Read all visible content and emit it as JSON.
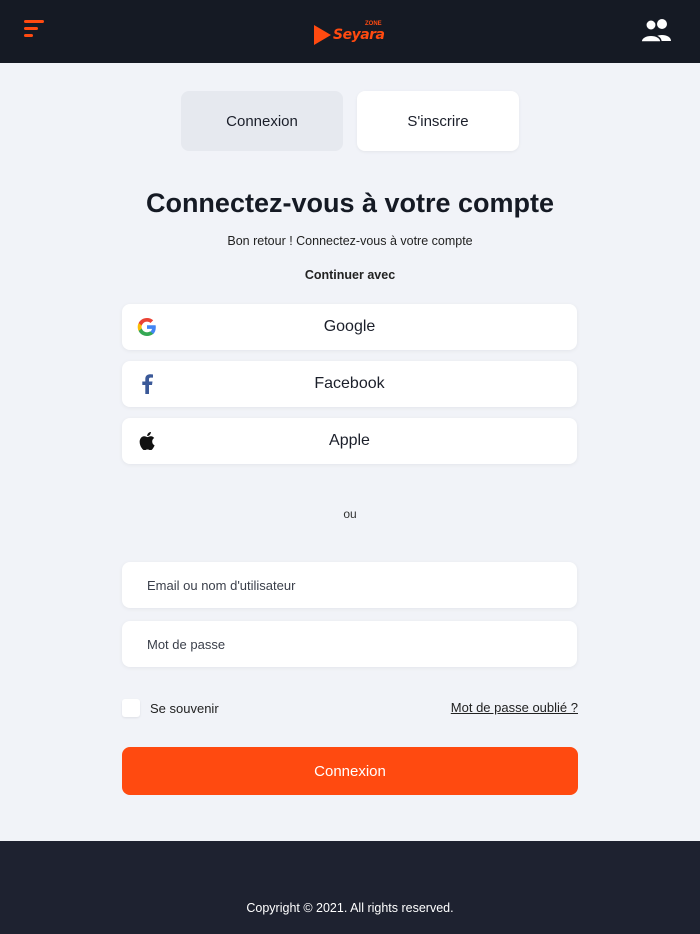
{
  "header": {
    "menu_icon": "hamburger-menu-icon",
    "logo_text": "Seyara",
    "logo_badge": "ZONE",
    "users_icon": "users-icon"
  },
  "tabs": [
    {
      "label": "Connexion",
      "active": true
    },
    {
      "label": "S'inscrire",
      "active": false
    }
  ],
  "heading": {
    "title": "Connectez-vous à votre compte",
    "subtitle": "Bon retour ! Connectez-vous à votre compte",
    "continue_with": "Continuer avec"
  },
  "social": {
    "google": {
      "label": "Google",
      "icon": "google-icon"
    },
    "facebook": {
      "label": "Facebook",
      "icon": "facebook-icon"
    },
    "apple": {
      "label": "Apple",
      "icon": "apple-icon"
    }
  },
  "separator": "ou",
  "form": {
    "email_placeholder": "Email ou nom d'utilisateur",
    "email_value": "",
    "password_placeholder": "Mot de passe",
    "password_value": "",
    "remember_label": "Se souvenir",
    "remember_checked": false,
    "forgot_label": "Mot de passe oublié ?",
    "submit_label": "Connexion"
  },
  "footer": {
    "copyright": "Copyright © 2021. All rights reserved."
  },
  "colors": {
    "accent": "#ff4a10",
    "header_bg": "#151a24",
    "footer_bg": "#1e2230",
    "page_bg": "#f1f3f8"
  }
}
